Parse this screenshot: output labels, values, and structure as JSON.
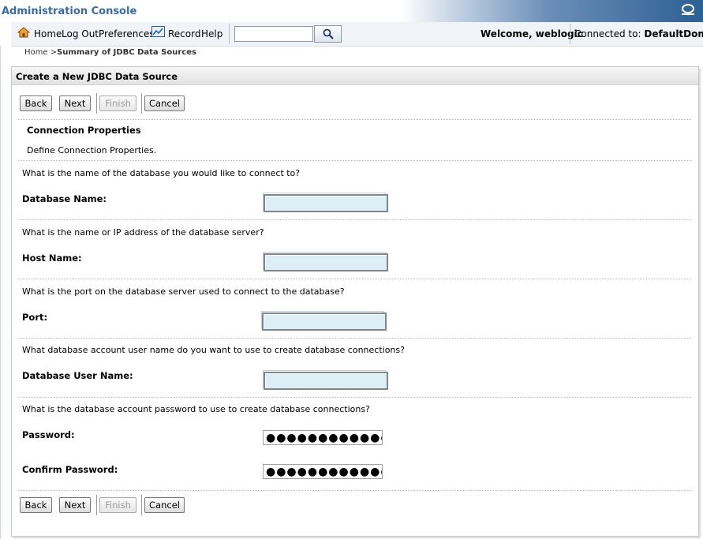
{
  "app": {
    "title": "Administration Console"
  },
  "toolbar": {
    "home": "Home",
    "logout": "Log Out",
    "preferences": "Preferences",
    "record": "Record",
    "help": "Help",
    "search_value": "",
    "welcome": "Welcome, weblogic",
    "connected_label": "Connected to:",
    "connected_domain": "DefaultDomain"
  },
  "breadcrumb": {
    "home": "Home >",
    "current": "Summary of JDBC Data Sources"
  },
  "panel": {
    "title": "Create a New JDBC Data Source",
    "buttons": {
      "back": "Back",
      "next": "Next",
      "finish": "Finish",
      "cancel": "Cancel"
    },
    "section_title": "Connection Properties",
    "section_desc": "Define Connection Properties.",
    "fields": {
      "db_name": {
        "question": "What is the name of the database you would like to connect to?",
        "label": "Database Name:",
        "value": ""
      },
      "host": {
        "question": "What is the name or IP address of the database server?",
        "label": "Host Name:",
        "value": ""
      },
      "port": {
        "question": "What is the port on the database server used to connect to the database?",
        "label": "Port:",
        "value": ""
      },
      "user": {
        "question": "What database account user name do you want to use to create database connections?",
        "label": "Database User Name:",
        "value": ""
      },
      "password": {
        "question": "What is the database account password to use to create database connections?",
        "label": "Password:",
        "value": "●●●●●●●●●●●●●"
      },
      "confirm": {
        "label": "Confirm Password:",
        "value": "●●●●●●●●●●●●●"
      }
    }
  },
  "icons": {
    "home": "home-icon",
    "record": "record-chart-icon",
    "search": "magnifier-icon",
    "logo": "oracle-logo-icon"
  }
}
